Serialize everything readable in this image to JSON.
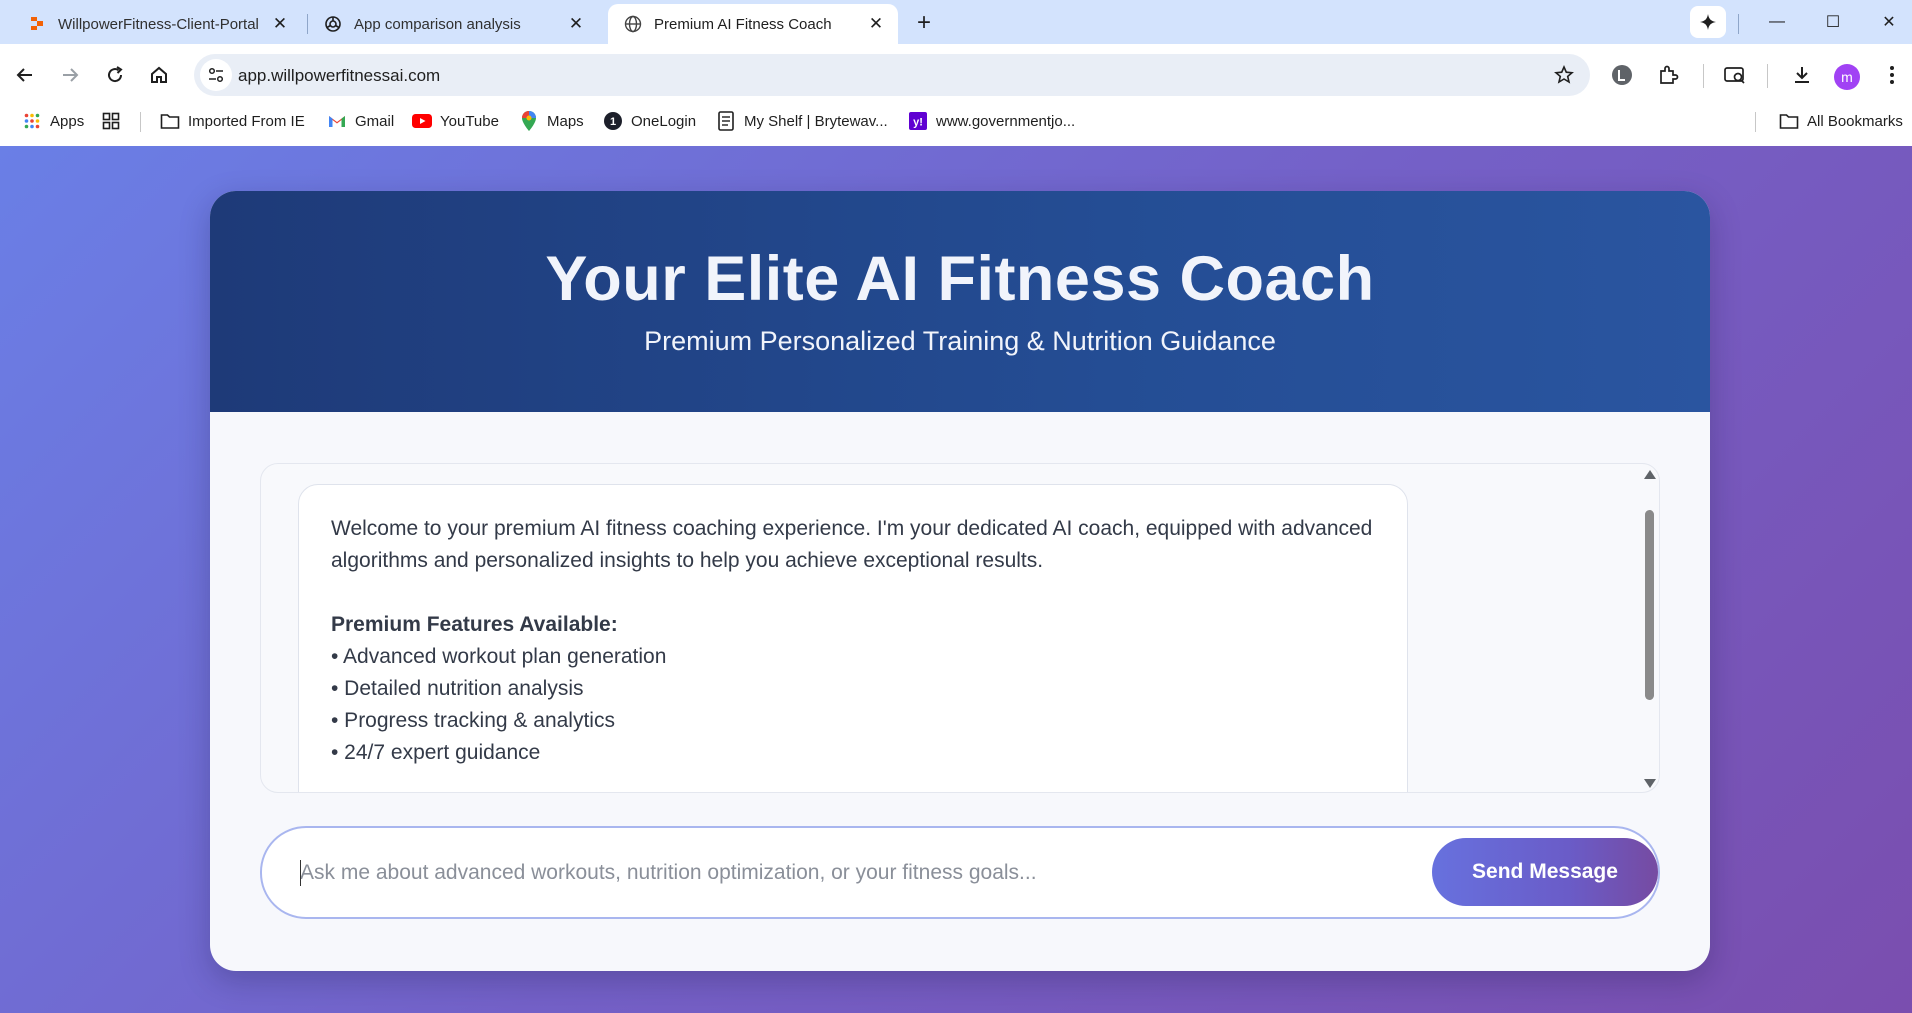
{
  "browser": {
    "tabs": [
      {
        "title": "WillpowerFitness-Client-Portal",
        "favicon": "replit-icon",
        "active": false
      },
      {
        "title": "App comparison analysis",
        "favicon": "chatgpt-icon",
        "active": false
      },
      {
        "title": "Premium AI Fitness Coach",
        "favicon": "globe-icon",
        "active": true
      }
    ],
    "new_tab_label": "+",
    "window_controls": {
      "minimize": "—",
      "maximize": "☐",
      "close": "✕"
    },
    "url": "app.willpowerfitnessai.com",
    "profile_initial": "m",
    "bookmarks": [
      {
        "label": "Apps",
        "icon": "apps-grid-icon"
      },
      {
        "label": "",
        "icon": "tab-groups-icon"
      },
      {
        "label": "Imported From IE",
        "icon": "folder-icon"
      },
      {
        "label": "Gmail",
        "icon": "gmail-icon"
      },
      {
        "label": "YouTube",
        "icon": "youtube-icon"
      },
      {
        "label": "Maps",
        "icon": "maps-icon"
      },
      {
        "label": "OneLogin",
        "icon": "onelogin-icon"
      },
      {
        "label": "My Shelf | Brytewav...",
        "icon": "document-icon"
      },
      {
        "label": "www.governmentjo...",
        "icon": "yahoo-icon"
      }
    ],
    "all_bookmarks_label": "All Bookmarks"
  },
  "page": {
    "title": "Your Elite AI Fitness Coach",
    "subtitle": "Premium Personalized Training & Nutrition Guidance",
    "welcome_message": "Welcome to your premium AI fitness coaching experience. I'm your dedicated AI coach, equipped with advanced algorithms and personalized insights to help you achieve exceptional results.",
    "features_heading": "Premium Features Available:",
    "features": [
      "• Advanced workout plan generation",
      "• Detailed nutrition analysis",
      "• Progress tracking & analytics",
      "• 24/7 expert guidance"
    ],
    "input_placeholder": "Ask me about advanced workouts, nutrition optimization, or your fitness goals...",
    "send_button_label": "Send Message"
  },
  "colors": {
    "tabstrip": "#d3e3fd",
    "hero": "#1e3a78",
    "accent": "#6771de",
    "page_bg_start": "#6a7fe6",
    "page_bg_end": "#7a4eaf",
    "profile": "#a142f4"
  }
}
